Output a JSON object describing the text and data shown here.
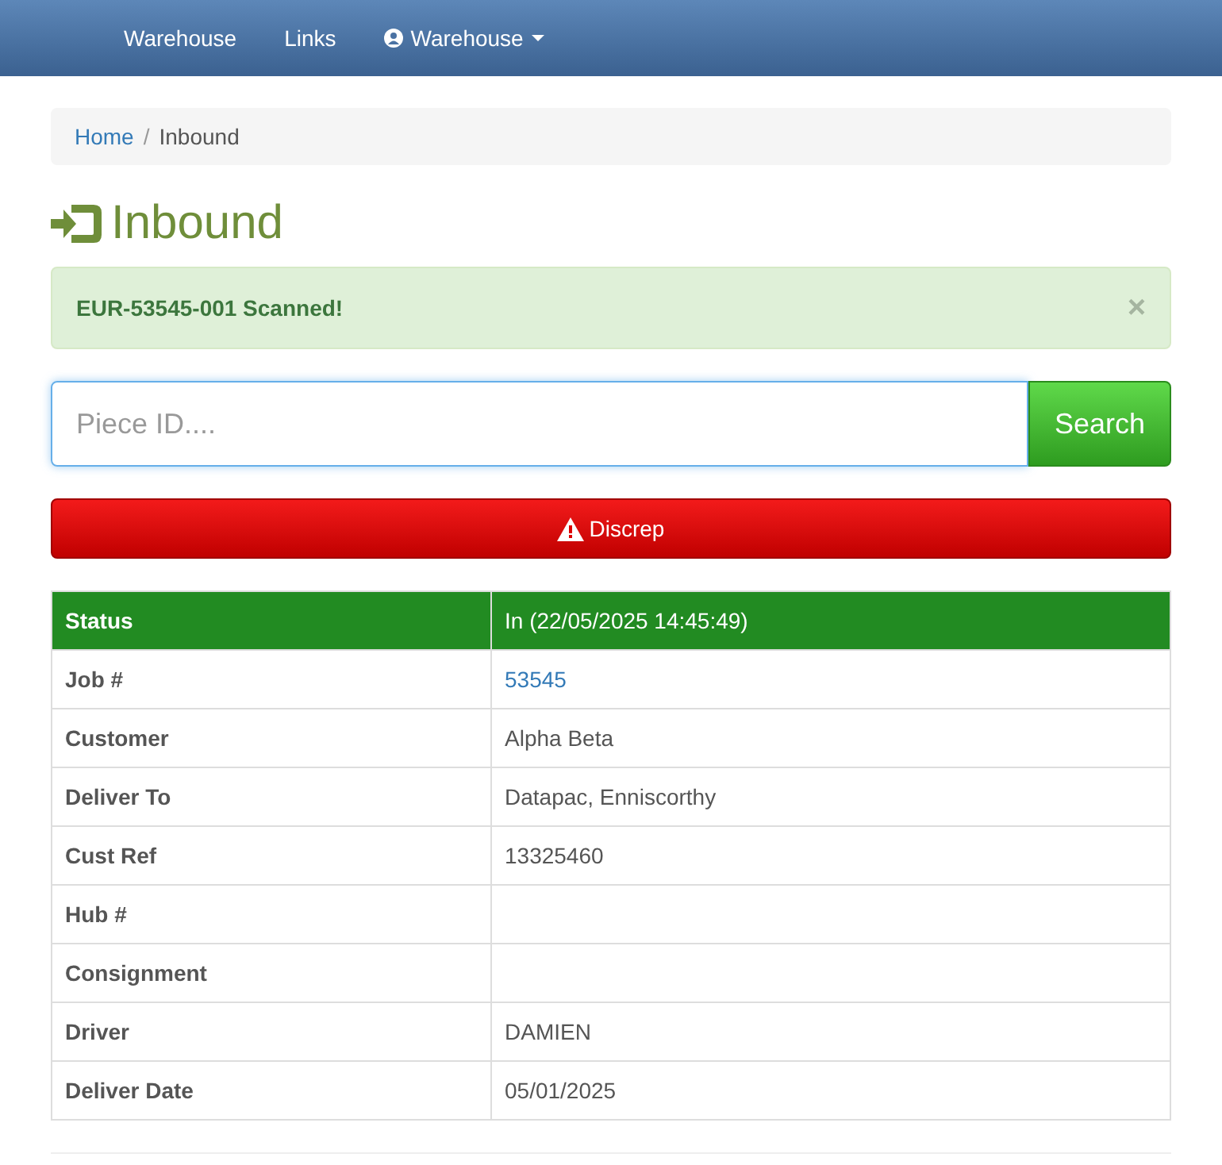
{
  "navbar": {
    "items": [
      {
        "label": "Warehouse",
        "kind": "link"
      },
      {
        "label": "Links",
        "kind": "link"
      },
      {
        "label": "Warehouse",
        "kind": "dropdown"
      }
    ]
  },
  "breadcrumb": [
    {
      "label": "Home",
      "selected": false
    },
    {
      "label": "Inbound",
      "selected": true
    }
  ],
  "breadcrumb_separator": "/",
  "page_title": "Inbound",
  "alert": {
    "message": "EUR-53545-001 Scanned!",
    "close": "×"
  },
  "search": {
    "placeholder": "Piece ID....",
    "button": "Search"
  },
  "discrep_button": "Discrep",
  "table": {
    "rows": [
      {
        "label": "Status",
        "value": "In (22/05/2025 14:45:49)",
        "kind": "status"
      },
      {
        "label": "Job #",
        "value": "53545",
        "kind": "link"
      },
      {
        "label": "Customer",
        "value": "Alpha Beta",
        "kind": "text"
      },
      {
        "label": "Deliver To",
        "value": "Datapac, Enniscorthy",
        "kind": "text"
      },
      {
        "label": "Cust Ref",
        "value": "13325460",
        "kind": "text"
      },
      {
        "label": "Hub #",
        "value": "",
        "kind": "text"
      },
      {
        "label": "Consignment",
        "value": "",
        "kind": "text"
      },
      {
        "label": "Driver",
        "value": "DAMIEN",
        "kind": "text"
      },
      {
        "label": "Deliver Date",
        "value": "05/01/2025",
        "kind": "text"
      }
    ]
  }
}
